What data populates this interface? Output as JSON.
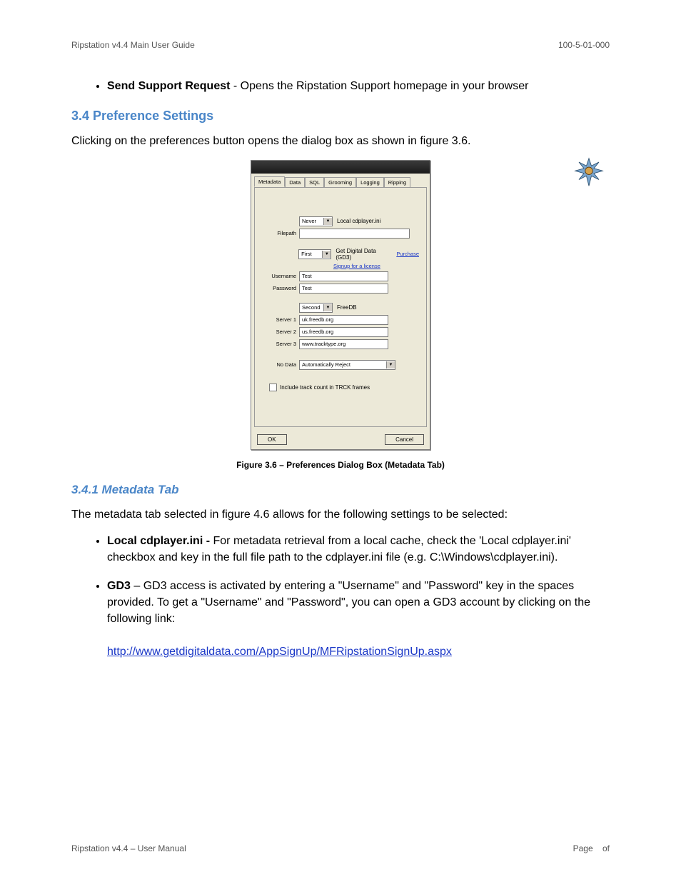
{
  "header": {
    "left": "Ripstation v4.4 Main User Guide",
    "right": "100-5-01-000"
  },
  "top_bullet": {
    "term": "Send Support Request",
    "desc": " - Opens the Ripstation Support homepage in your browser"
  },
  "h34": "3.4 Preference Settings",
  "p34": "Clicking on the preferences button opens the dialog box as shown in figure 3.6.",
  "dialog": {
    "tabs": [
      "Metadata",
      "Data",
      "SQL",
      "Grooming",
      "Logging",
      "Ripping"
    ],
    "row1": {
      "sel": "Never",
      "label": "Local cdplayer.ini"
    },
    "filepath_label": "Filepath",
    "filepath_value": "",
    "row2": {
      "sel": "First",
      "label": "Get Digital Data (GD3)",
      "link": "Purchase"
    },
    "signup_link": "Signup for a license",
    "username_label": "Username",
    "username_value": "Test",
    "password_label": "Password",
    "password_value": "Test",
    "row3": {
      "sel": "Second",
      "label": "FreeDB"
    },
    "server1_label": "Server 1",
    "server1_value": "uk.freedb.org",
    "server2_label": "Server 2",
    "server2_value": "us.freedb.org",
    "server3_label": "Server 3",
    "server3_value": "www.tracktype.org",
    "nodata_label": "No Data",
    "nodata_value": "Automatically Reject",
    "chk_label": "Include track count in TRCK frames",
    "ok": "OK",
    "cancel": "Cancel"
  },
  "fig_caption": "Figure 3.6 – Preferences Dialog Box (Metadata Tab)",
  "h341": "3.4.1  Metadata Tab",
  "p341": "The metadata tab selected in figure 4.6 allows for the following settings to be selected:",
  "b1": {
    "term": "Local cdplayer.ini - ",
    "desc": "For metadata retrieval from a local cache, check the 'Local cdplayer.ini' checkbox and key in the full file path to the cdplayer.ini file (e.g. C:\\Windows\\cdplayer.ini)."
  },
  "b2": {
    "term": "GD3",
    "desc": " – GD3 access is activated by entering a \"Username\" and \"Password\" key in the spaces provided.  To get a \"Username\" and \"Password\", you can open a GD3 account by clicking on the following link:"
  },
  "b2_link": "http://www.getdigitaldata.com/AppSignUp/MFRipstationSignUp.aspx",
  "footer": {
    "left": "Ripstation v4.4 – User Manual",
    "right_a": "Page",
    "right_b": "of"
  }
}
